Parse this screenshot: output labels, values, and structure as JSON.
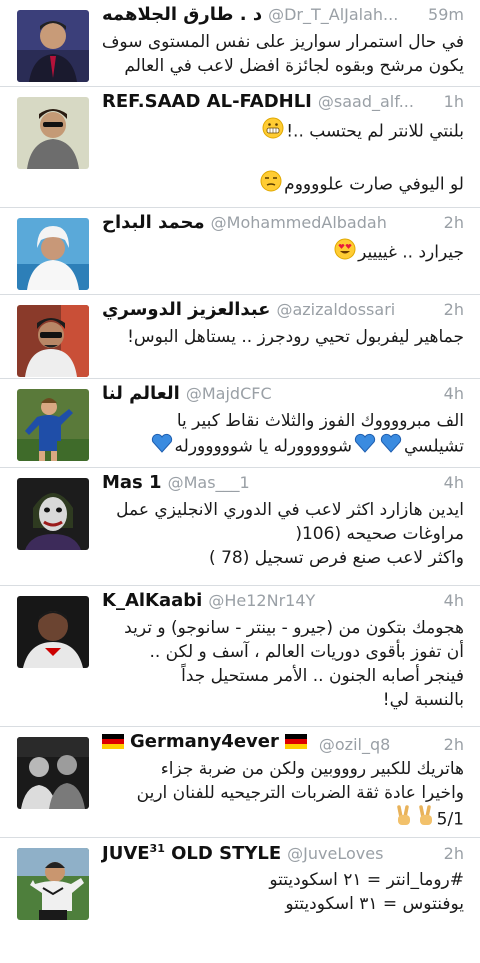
{
  "tweets": [
    {
      "name": "د . طارق الجلاهمه",
      "handle": "@Dr_T_AlJalah...",
      "time": "59m",
      "lines": [
        "في حال استمرار سواريز على نفس المستوى سوف",
        "يكون مرشح وبقوه لجائزة افضل لاعب في العالم"
      ]
    },
    {
      "name": "REF.SAAD AL-FADHLI",
      "handle": "@saad_alf...",
      "time": "1h",
      "lines": [
        "بلنتي للانتر لم يحتسب ..!",
        "",
        "لو اليوفي صارت علووووم"
      ],
      "emojis": [
        "grinning-face-emoji",
        "unamused-face-emoji"
      ]
    },
    {
      "name": "محمد البداح",
      "handle": "@MohammedAlbadah",
      "time": "2h",
      "lines": [
        "جيرارد .. غيييير"
      ],
      "emojis": [
        "heart-eyes-emoji"
      ]
    },
    {
      "name": "عبدالعزيز الدوسري",
      "handle": "@azizaldossari",
      "time": "2h",
      "lines": [
        "جماهير ليفربول تحيي رودجرز .. يستاهل البوس!"
      ]
    },
    {
      "name": "العالم لنا",
      "handle": "@MajdCFC",
      "time": "4h",
      "lines": [
        "الف مبرووووك الفوز والثلاث نقاط كبير يا",
        "تشيلسي",
        "شووووورله يا شووووورله"
      ],
      "emojis": [
        "blue-heart-emoji"
      ]
    },
    {
      "name": "Mas 1",
      "handle": "@Mas___1",
      "time": "4h",
      "lines": [
        "ايدين هازارد اكثر لاعب في الدوري الانجليزي عمل",
        "مراوغات صحيحه (106(",
        "واكثر لاعب صنع فرص تسجيل (78 )"
      ]
    },
    {
      "name": "K_AlKaabi",
      "handle": "@He12Nr14Y",
      "time": "4h",
      "lines": [
        "هجومك بتكون من (جيرو - بينتر - سانوجو) و تريد",
        "أن تفوز بأقوى دوريات العالم ، آسف و لكن ..",
        "فينجر أصابه الجنون .. الأمر مستحيل جداً",
        "بالنسبة لي!"
      ]
    },
    {
      "name": "Germany4ever",
      "handle": "@ozil_q8",
      "time": "2h",
      "lines": [
        "هاتريك للكبير روووبين ولكن من ضربة جزاء",
        "واخيرا عادة ثقة الضربات الترجيحيه للفنان ارين",
        "5/1"
      ],
      "emojis": [
        "victory-hand-emoji"
      ]
    },
    {
      "name_main": "JUVE",
      "name_sup": "31",
      "name_rest": " OLD STYLE",
      "handle": "@JuveLoves",
      "time": "2h",
      "lines": [
        "#روما_انتر = ٢١ اسكوديتتو",
        "يوفنتوس = ٣١ اسكوديتتو"
      ]
    }
  ],
  "colors": {
    "meta_text": "#9aa0a6",
    "separator": "#d9dde1",
    "name_text": "#111111"
  }
}
